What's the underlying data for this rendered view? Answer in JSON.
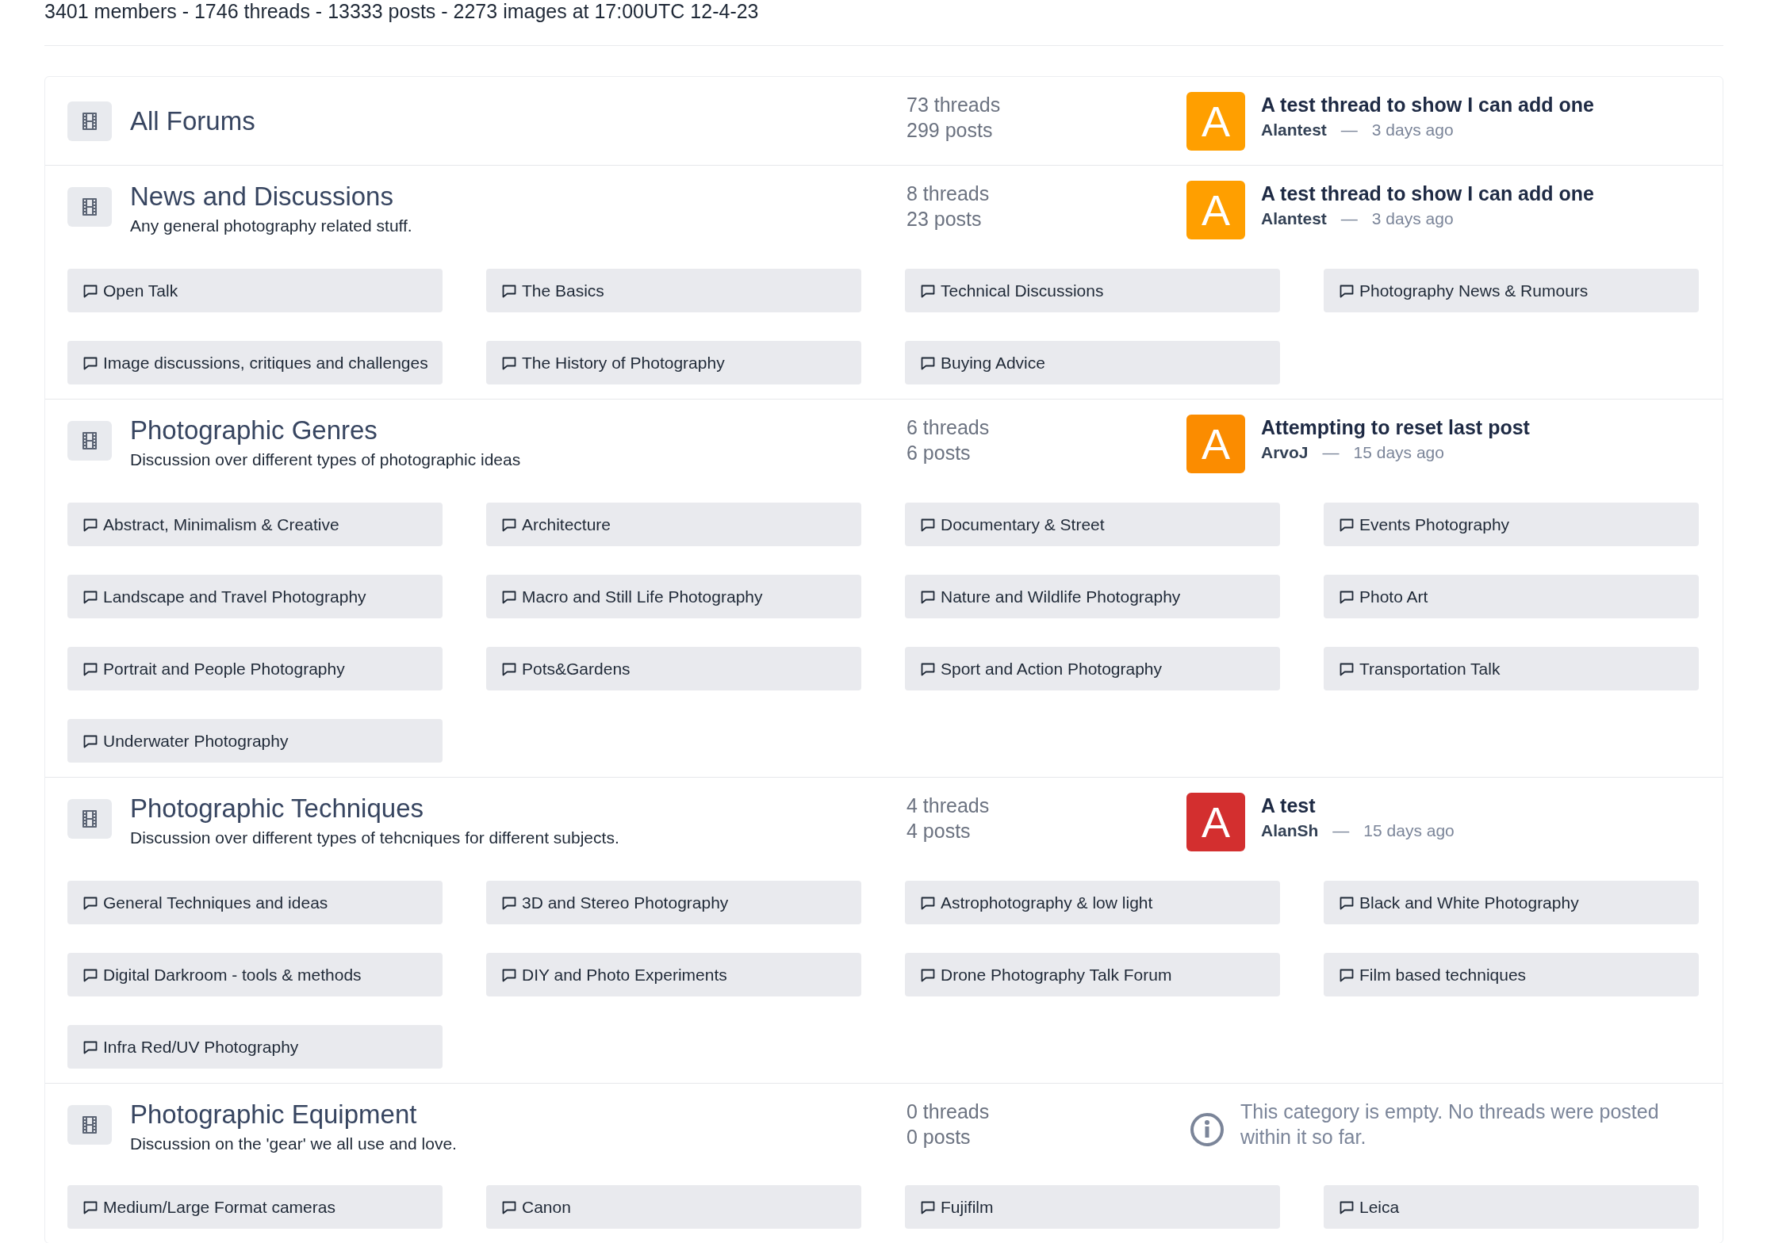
{
  "stats_line": "3401 members - 1746 threads - 13333 posts - 2273 images at 17:00UTC 12-4-23",
  "categories": [
    {
      "title": "All Forums",
      "threads": "73 threads",
      "posts": "299 posts",
      "last_post": {
        "kind": "thread",
        "letter": "A",
        "color": "#ff9f00",
        "title": "A test thread to show I can add one",
        "author": "Alantest",
        "separator": "—",
        "time": "3 days ago"
      }
    },
    {
      "title": "News and Discussions",
      "description": "Any general photography related stuff.",
      "threads": "8 threads",
      "posts": "23 posts",
      "last_post": {
        "kind": "thread",
        "letter": "A",
        "color": "#ff9f00",
        "title": "A test thread to show I can add one",
        "author": "Alantest",
        "separator": "—",
        "time": "3 days ago"
      },
      "forums": [
        "Open Talk",
        "The Basics",
        "Technical Discussions",
        "Photography News & Rumours",
        "Image discussions, critiques and challenges",
        "The History of Photography",
        "Buying Advice"
      ]
    },
    {
      "title": "Photographic Genres",
      "description": "Discussion over different types of photographic ideas",
      "threads": "6 threads",
      "posts": "6 posts",
      "last_post": {
        "kind": "thread",
        "letter": "A",
        "color": "#fb8c00",
        "title": "Attempting to reset last post",
        "author": "ArvoJ",
        "separator": "—",
        "time": "15 days ago"
      },
      "forums": [
        "Abstract, Minimalism & Creative",
        "Architecture",
        "Documentary & Street",
        "Events Photography",
        "Landscape and Travel Photography",
        "Macro and Still Life Photography",
        "Nature and Wildlife Photography",
        "Photo Art",
        "Portrait and People Photography",
        "Pots&Gardens",
        "Sport and Action Photography",
        "Transportation Talk",
        "Underwater Photography"
      ]
    },
    {
      "title": "Photographic Techniques",
      "description": "Discussion over different types of tehcniques for different subjects.",
      "threads": "4 threads",
      "posts": "4 posts",
      "last_post": {
        "kind": "thread",
        "letter": "A",
        "color": "#d32f2f",
        "title": "A test",
        "author": "AlanSh",
        "separator": "—",
        "time": "15 days ago"
      },
      "forums": [
        "General Techniques and ideas",
        "3D and Stereo Photography",
        "Astrophotography & low light",
        "Black and White Photography",
        "Digital Darkroom - tools & methods",
        "DIY and Photo Experiments",
        "Drone Photography Talk Forum",
        "Film based techniques",
        "Infra Red/UV Photography"
      ]
    },
    {
      "title": "Photographic Equipment",
      "description": "Discussion on the 'gear' we all use and love.",
      "threads": "0 threads",
      "posts": "0 posts",
      "last_post": {
        "kind": "empty",
        "message": "This category is empty. No threads were posted within it so far."
      },
      "forums": [
        "Medium/Large Format cameras",
        "Canon",
        "Fujifilm",
        "Leica"
      ]
    }
  ]
}
